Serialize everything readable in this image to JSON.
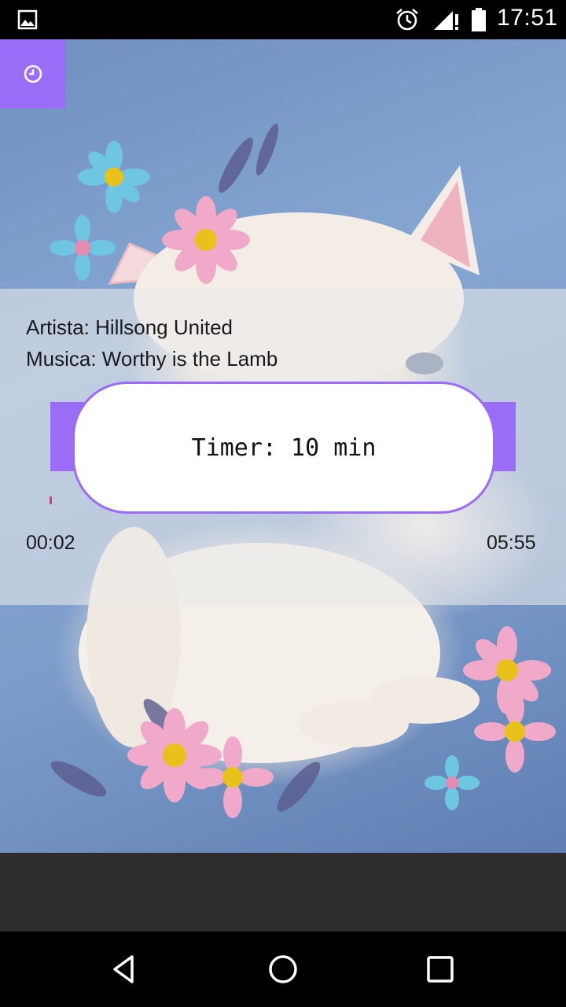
{
  "status_bar": {
    "time": "17:51",
    "icons": [
      "gallery-icon",
      "alarm-icon",
      "signal-icon",
      "battery-icon"
    ]
  },
  "player": {
    "artist_line": "Artista: Hillsong United",
    "music_line": "Musica: Worthy is the Lamb",
    "elapsed": "00:02",
    "total": "05:55"
  },
  "timer_dialog": {
    "text": "Timer: 10 min"
  },
  "timer_button": {
    "icon": "clock-icon"
  },
  "nav": {
    "icons": [
      "back-icon",
      "home-icon",
      "recents-icon"
    ]
  },
  "colors": {
    "accent": "#9b6cf6",
    "progress": "#e8337a"
  }
}
